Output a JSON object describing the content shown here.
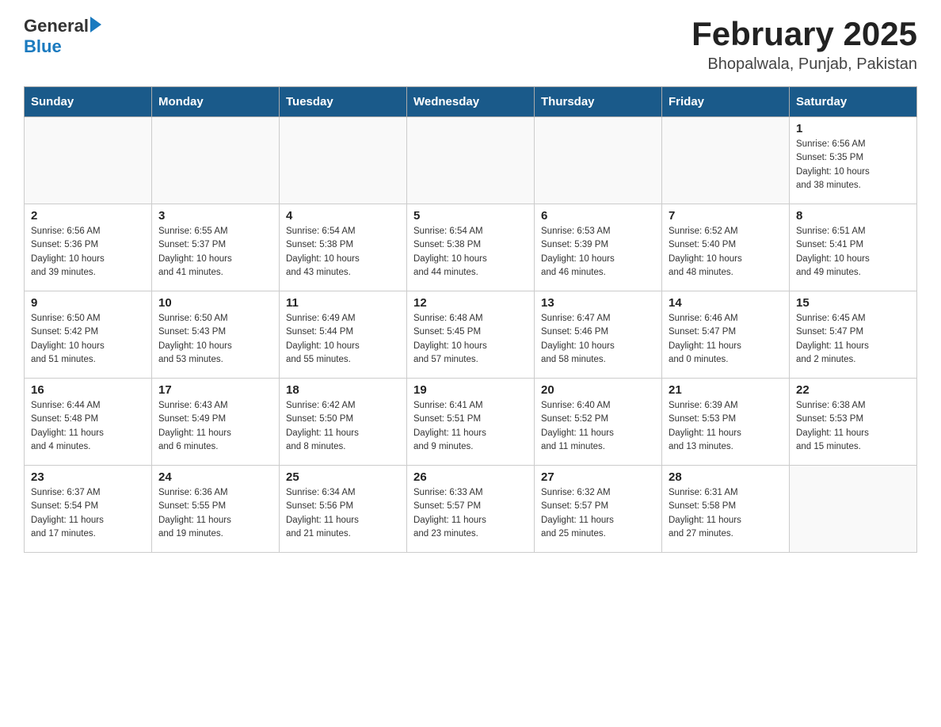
{
  "header": {
    "logo_general": "General",
    "logo_blue": "Blue",
    "title": "February 2025",
    "subtitle": "Bhopalwala, Punjab, Pakistan"
  },
  "weekdays": [
    "Sunday",
    "Monday",
    "Tuesday",
    "Wednesday",
    "Thursday",
    "Friday",
    "Saturday"
  ],
  "weeks": [
    [
      {
        "day": "",
        "info": ""
      },
      {
        "day": "",
        "info": ""
      },
      {
        "day": "",
        "info": ""
      },
      {
        "day": "",
        "info": ""
      },
      {
        "day": "",
        "info": ""
      },
      {
        "day": "",
        "info": ""
      },
      {
        "day": "1",
        "info": "Sunrise: 6:56 AM\nSunset: 5:35 PM\nDaylight: 10 hours\nand 38 minutes."
      }
    ],
    [
      {
        "day": "2",
        "info": "Sunrise: 6:56 AM\nSunset: 5:36 PM\nDaylight: 10 hours\nand 39 minutes."
      },
      {
        "day": "3",
        "info": "Sunrise: 6:55 AM\nSunset: 5:37 PM\nDaylight: 10 hours\nand 41 minutes."
      },
      {
        "day": "4",
        "info": "Sunrise: 6:54 AM\nSunset: 5:38 PM\nDaylight: 10 hours\nand 43 minutes."
      },
      {
        "day": "5",
        "info": "Sunrise: 6:54 AM\nSunset: 5:38 PM\nDaylight: 10 hours\nand 44 minutes."
      },
      {
        "day": "6",
        "info": "Sunrise: 6:53 AM\nSunset: 5:39 PM\nDaylight: 10 hours\nand 46 minutes."
      },
      {
        "day": "7",
        "info": "Sunrise: 6:52 AM\nSunset: 5:40 PM\nDaylight: 10 hours\nand 48 minutes."
      },
      {
        "day": "8",
        "info": "Sunrise: 6:51 AM\nSunset: 5:41 PM\nDaylight: 10 hours\nand 49 minutes."
      }
    ],
    [
      {
        "day": "9",
        "info": "Sunrise: 6:50 AM\nSunset: 5:42 PM\nDaylight: 10 hours\nand 51 minutes."
      },
      {
        "day": "10",
        "info": "Sunrise: 6:50 AM\nSunset: 5:43 PM\nDaylight: 10 hours\nand 53 minutes."
      },
      {
        "day": "11",
        "info": "Sunrise: 6:49 AM\nSunset: 5:44 PM\nDaylight: 10 hours\nand 55 minutes."
      },
      {
        "day": "12",
        "info": "Sunrise: 6:48 AM\nSunset: 5:45 PM\nDaylight: 10 hours\nand 57 minutes."
      },
      {
        "day": "13",
        "info": "Sunrise: 6:47 AM\nSunset: 5:46 PM\nDaylight: 10 hours\nand 58 minutes."
      },
      {
        "day": "14",
        "info": "Sunrise: 6:46 AM\nSunset: 5:47 PM\nDaylight: 11 hours\nand 0 minutes."
      },
      {
        "day": "15",
        "info": "Sunrise: 6:45 AM\nSunset: 5:47 PM\nDaylight: 11 hours\nand 2 minutes."
      }
    ],
    [
      {
        "day": "16",
        "info": "Sunrise: 6:44 AM\nSunset: 5:48 PM\nDaylight: 11 hours\nand 4 minutes."
      },
      {
        "day": "17",
        "info": "Sunrise: 6:43 AM\nSunset: 5:49 PM\nDaylight: 11 hours\nand 6 minutes."
      },
      {
        "day": "18",
        "info": "Sunrise: 6:42 AM\nSunset: 5:50 PM\nDaylight: 11 hours\nand 8 minutes."
      },
      {
        "day": "19",
        "info": "Sunrise: 6:41 AM\nSunset: 5:51 PM\nDaylight: 11 hours\nand 9 minutes."
      },
      {
        "day": "20",
        "info": "Sunrise: 6:40 AM\nSunset: 5:52 PM\nDaylight: 11 hours\nand 11 minutes."
      },
      {
        "day": "21",
        "info": "Sunrise: 6:39 AM\nSunset: 5:53 PM\nDaylight: 11 hours\nand 13 minutes."
      },
      {
        "day": "22",
        "info": "Sunrise: 6:38 AM\nSunset: 5:53 PM\nDaylight: 11 hours\nand 15 minutes."
      }
    ],
    [
      {
        "day": "23",
        "info": "Sunrise: 6:37 AM\nSunset: 5:54 PM\nDaylight: 11 hours\nand 17 minutes."
      },
      {
        "day": "24",
        "info": "Sunrise: 6:36 AM\nSunset: 5:55 PM\nDaylight: 11 hours\nand 19 minutes."
      },
      {
        "day": "25",
        "info": "Sunrise: 6:34 AM\nSunset: 5:56 PM\nDaylight: 11 hours\nand 21 minutes."
      },
      {
        "day": "26",
        "info": "Sunrise: 6:33 AM\nSunset: 5:57 PM\nDaylight: 11 hours\nand 23 minutes."
      },
      {
        "day": "27",
        "info": "Sunrise: 6:32 AM\nSunset: 5:57 PM\nDaylight: 11 hours\nand 25 minutes."
      },
      {
        "day": "28",
        "info": "Sunrise: 6:31 AM\nSunset: 5:58 PM\nDaylight: 11 hours\nand 27 minutes."
      },
      {
        "day": "",
        "info": ""
      }
    ]
  ]
}
